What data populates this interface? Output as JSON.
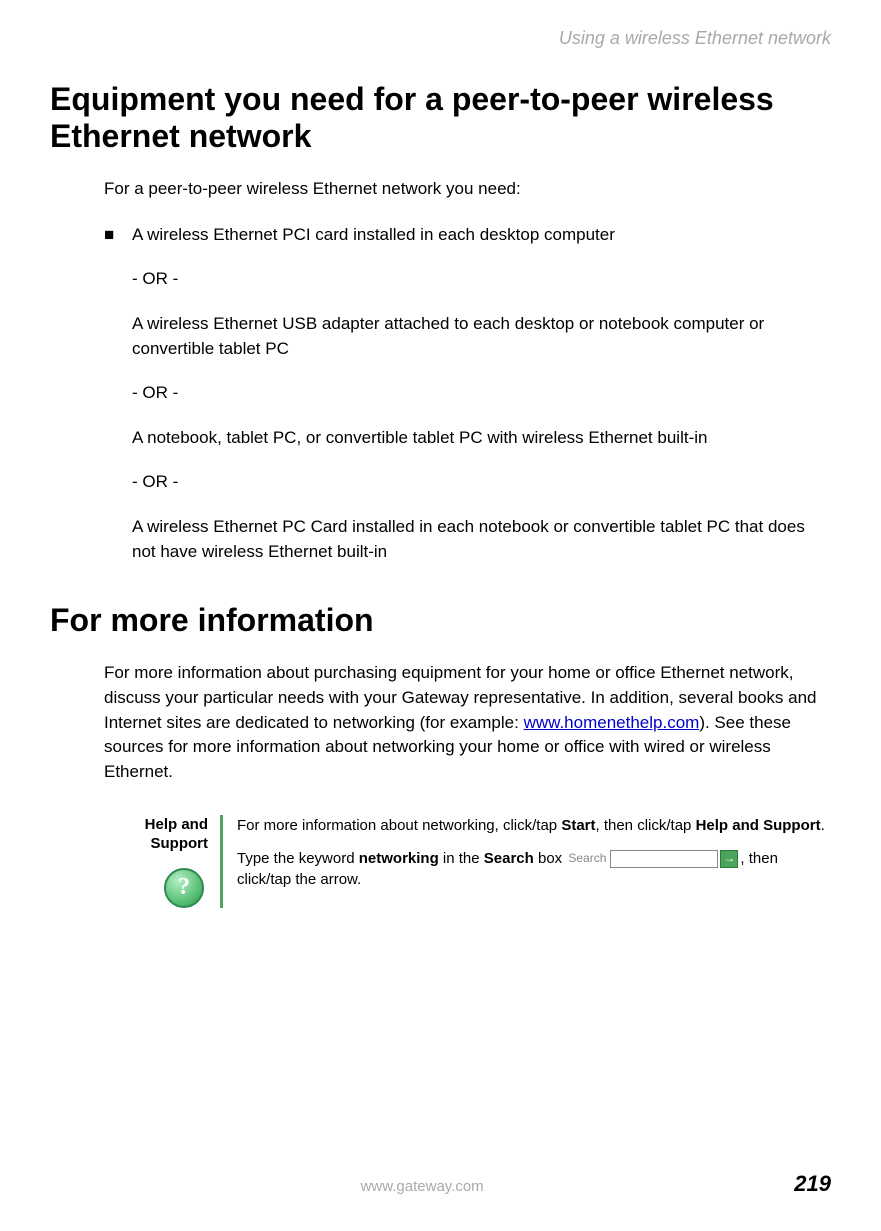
{
  "header": {
    "section": "Using a wireless Ethernet network"
  },
  "h1": "Equipment you need for a peer-to-peer wireless Ethernet network",
  "intro": "For a peer-to-peer wireless Ethernet network you need:",
  "bullet": {
    "marker": "■",
    "item1": "A wireless Ethernet PCI card installed in each desktop computer",
    "or": "- OR -",
    "item2": "A wireless Ethernet USB adapter attached to each desktop or notebook computer or convertible tablet PC",
    "item3": "A notebook, tablet PC, or convertible tablet PC with wireless Ethernet built-in",
    "item4": "A wireless Ethernet PC Card installed in each notebook or convertible tablet PC that does not have wireless Ethernet built-in"
  },
  "h2": "For more information",
  "moreinfo": {
    "pre": "For more information about purchasing equipment for your home or office Ethernet network, discuss your particular needs with your Gateway representative. In addition, several books and Internet sites are dedicated to networking (for example: ",
    "link": "www.homenethelp.com",
    "post": "). See these sources for more information about networking your home or office with wired or wireless Ethernet."
  },
  "help": {
    "label": "Help and Support",
    "icon_glyph": "?",
    "p1_a": "For more information about networking, click/tap ",
    "p1_b": "Start",
    "p1_c": ", then click/tap ",
    "p1_d": "Help and Support",
    "p1_e": ".",
    "p2_a": "Type the keyword ",
    "p2_keyword": "networking",
    "p2_b": " in the ",
    "p2_c": "Search",
    "p2_d": " box ",
    "search_label": "Search",
    "search_arrow": "→",
    "p2_e": ", then click/tap the arrow."
  },
  "footer": {
    "url": "www.gateway.com",
    "page": "219"
  }
}
